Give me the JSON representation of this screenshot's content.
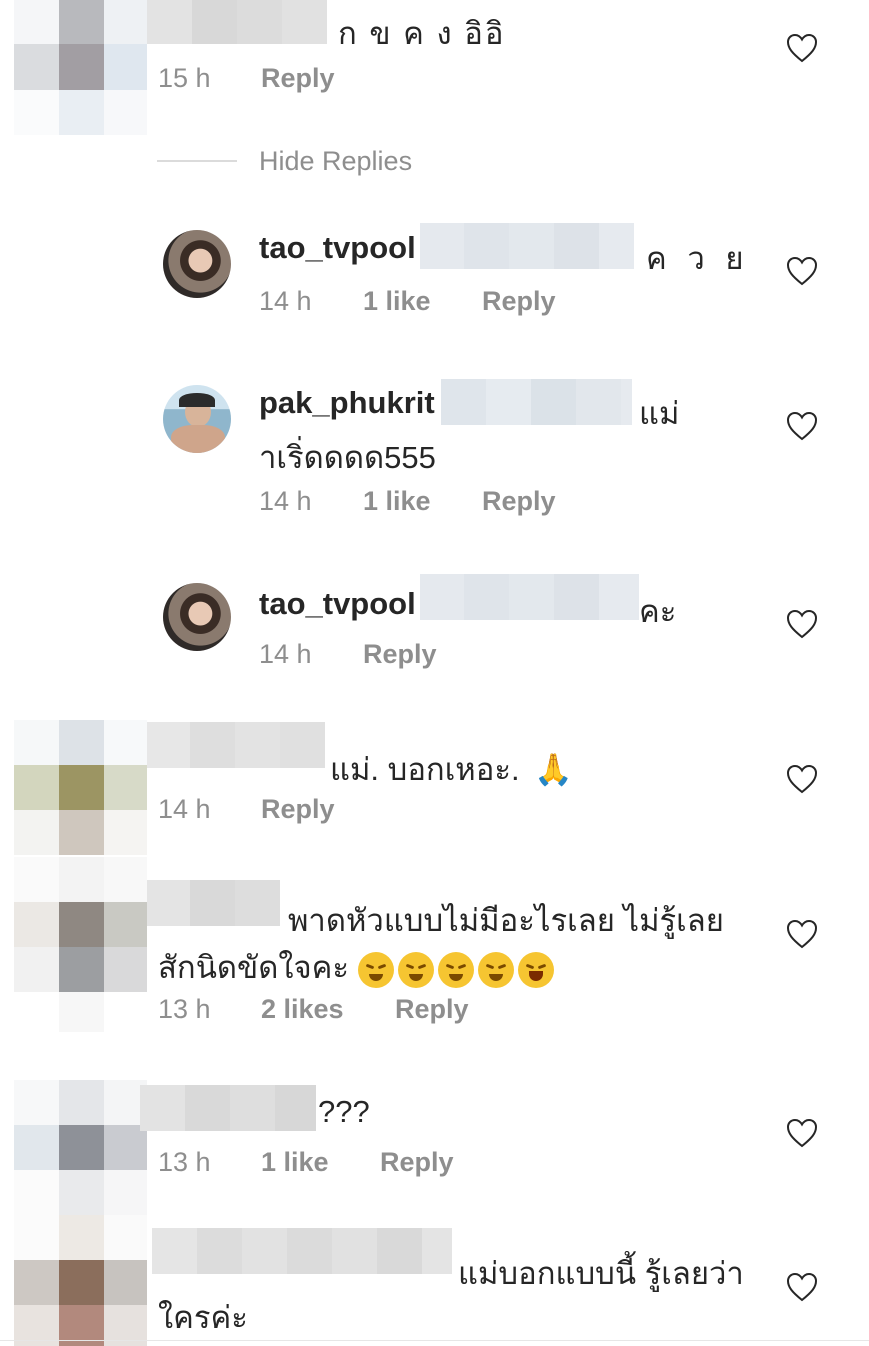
{
  "comments": [
    {
      "text": "ก ข ค ง อิอิ",
      "time": "15 h",
      "reply_label": "Reply"
    }
  ],
  "hide_replies": "Hide Replies",
  "replies": [
    {
      "username": "tao_tvpool",
      "text": "ค ว ย",
      "time": "14 h",
      "likes": "1 like",
      "reply_label": "Reply"
    },
    {
      "username": "pak_phukrit",
      "text": "แม่",
      "text2": "าเริ่ดดดด555",
      "time": "14 h",
      "likes": "1 like",
      "reply_label": "Reply"
    },
    {
      "username": "tao_tvpool",
      "text": "คะ",
      "time": "14 h",
      "reply_label": "Reply"
    }
  ],
  "more_comments": [
    {
      "text": "แม่. บอกเหอะ.",
      "emoji": "🙏",
      "time": "14 h",
      "reply_label": "Reply"
    },
    {
      "text": "พาดหัวแบบไม่มีอะไรเลย ไม่รู้เลย",
      "text2": "สักนิดขัดใจคะ",
      "time": "13 h",
      "likes": "2 likes",
      "reply_label": "Reply"
    },
    {
      "text": "???",
      "time": "13 h",
      "likes": "1 like",
      "reply_label": "Reply"
    },
    {
      "text": "แม่บอกแบบนี้ รู้เลยว่า",
      "text2": "ใครค่ะ"
    }
  ],
  "colors": {
    "text": "#262626",
    "muted": "#8e8e8e",
    "divider": "#dbdbdb"
  }
}
